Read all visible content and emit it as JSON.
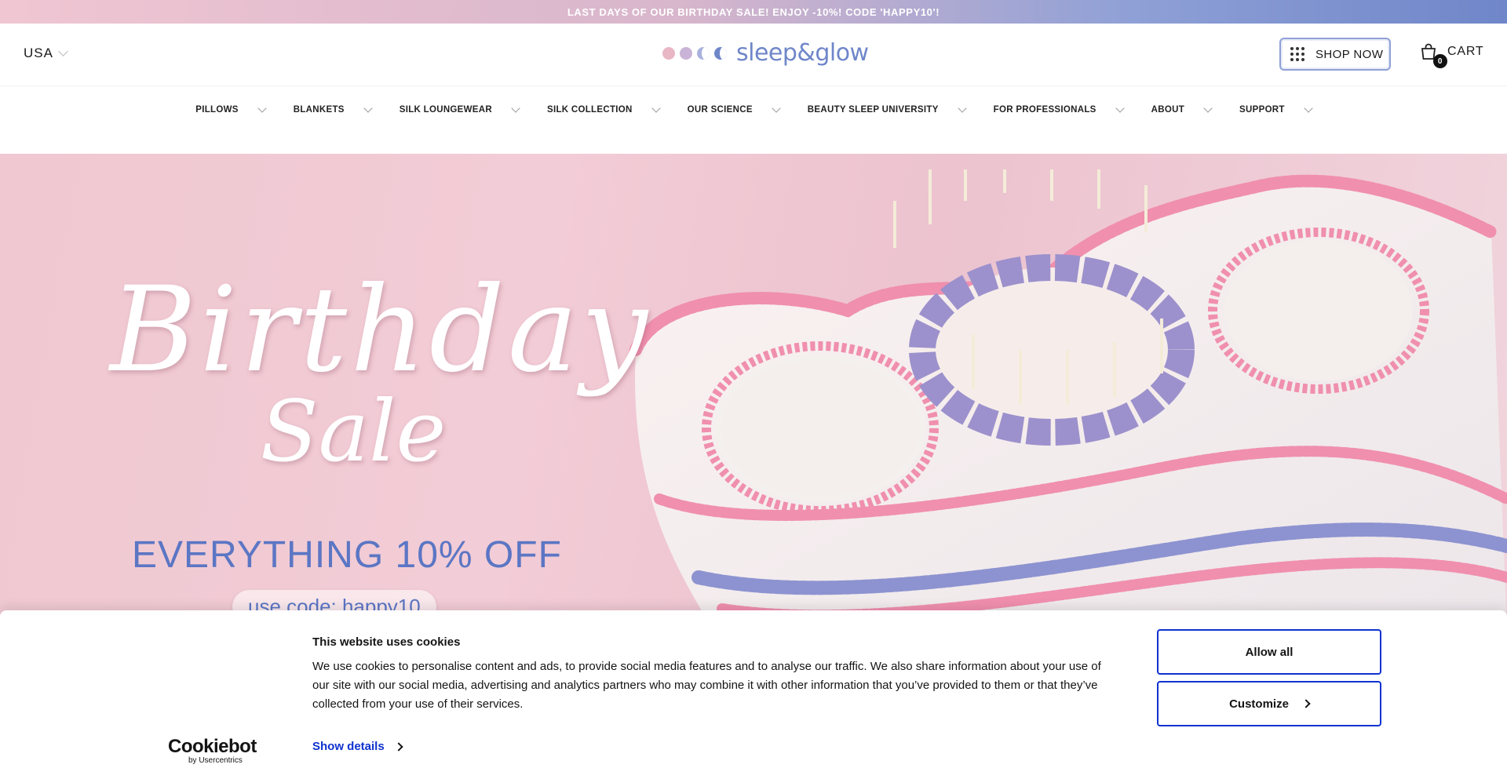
{
  "announcement": {
    "text": "LAST DAYS OF OUR BIRTHDAY SALE! ENJOY -10%! CODE 'HAPPY10'!"
  },
  "header": {
    "country": "USA",
    "logo_text": "sleep&glow",
    "shop_now": "SHOP NOW",
    "cart_label": "CART",
    "cart_count": "0"
  },
  "nav": {
    "items": [
      {
        "label": "PILLOWS"
      },
      {
        "label": "BLANKETS"
      },
      {
        "label": "SILK LOUNGEWEAR"
      },
      {
        "label": "SILK COLLECTION"
      },
      {
        "label": "OUR SCIENCE"
      },
      {
        "label": "BEAUTY SLEEP UNIVERSITY"
      },
      {
        "label": "FOR PROFESSIONALS"
      },
      {
        "label": "ABOUT"
      },
      {
        "label": "SUPPORT"
      }
    ]
  },
  "hero": {
    "title_line1": "Birthday",
    "title_line2": "Sale",
    "offer": "EVERYTHING 10% OFF",
    "code": "use code: happy10"
  },
  "cookie_banner": {
    "title": "This website uses cookies",
    "body": "We use cookies to personalise content and ads, to provide social media features and to analyse our traffic. We also share information about your use of our site with our social media, advertising and analytics partners who may combine it with other information that you’ve provided to them or that they’ve collected from your use of their services.",
    "show_details": "Show details",
    "allow_all": "Allow all",
    "customize": "Customize",
    "brand": "Cookiebot",
    "brand_sub": "by Usercentrics"
  },
  "colors": {
    "brand_blue": "#6f86c9",
    "brand_pink": "#efc8d1",
    "cookie_accent": "#1032cf"
  }
}
